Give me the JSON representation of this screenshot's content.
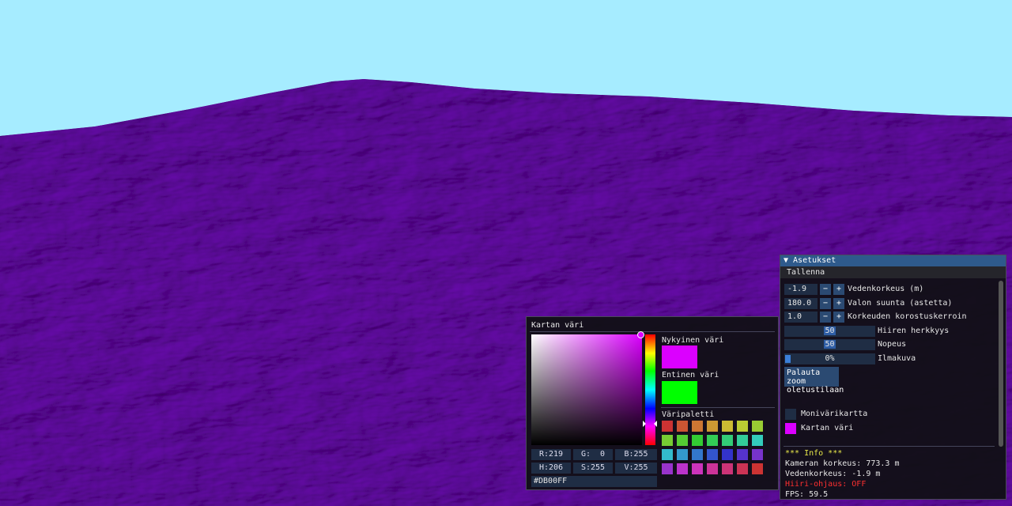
{
  "colors": {
    "sky": "#A6ECFF",
    "terrain": "#7A04A8",
    "terrain_dark": "#3A0052",
    "terrain_light": "#A020D8"
  },
  "color_picker": {
    "title": "Kartan väri",
    "current_label": "Nykyinen väri",
    "previous_label": "Entinen väri",
    "palette_label": "Väripaletti",
    "current_color": "#DB00FF",
    "previous_color": "#00FF00",
    "hue_color": "#DB00FF",
    "channels": {
      "r": "R:219",
      "g": "G:  0",
      "b": "B:255",
      "h": "H:206",
      "s": "S:255",
      "v": "V:255"
    },
    "hex": "#DB00FF",
    "palette": [
      "#cc3333",
      "#cc5533",
      "#cc7733",
      "#cc9933",
      "#ccbb33",
      "#bbcc33",
      "#99cc33",
      "#77cc33",
      "#55cc33",
      "#33cc33",
      "#33cc55",
      "#33cc77",
      "#33cc99",
      "#33ccbb",
      "#33bbcc",
      "#3399cc",
      "#3377cc",
      "#3355cc",
      "#3333cc",
      "#5533cc",
      "#7733cc",
      "#9933cc",
      "#bb33cc",
      "#cc33bb",
      "#cc3399",
      "#cc3377",
      "#cc3355",
      "#cc3333"
    ]
  },
  "settings": {
    "title": "▼ Asetukset",
    "menu_save": "Tallenna",
    "water_level": {
      "value": "-1.9",
      "label": "Vedenkorkeus (m)"
    },
    "light_direction": {
      "value": "180.0",
      "label": "Valon suunta (astetta)"
    },
    "height_exaggeration": {
      "value": "1.0",
      "label": "Korkeuden korostuskerroin"
    },
    "minus": "−",
    "plus": "+",
    "mouse_sensitivity": {
      "value": "50",
      "label": "Hiiren herkkyys",
      "fraction": 0.5
    },
    "speed": {
      "value": "50",
      "label": "Nopeus",
      "fraction": 0.5
    },
    "aerial": {
      "value": "0%",
      "label": "Ilmakuva",
      "fraction": 0.0
    },
    "reset_zoom_line1": "Palauta zoom",
    "reset_zoom_line2": "oletustilaan",
    "multicolor_map": {
      "label": "Monivärikartta",
      "color": "#1f2d44"
    },
    "map_color": {
      "label": "Kartan väri",
      "color": "#DB00FF"
    },
    "info_header": "*** Info ***",
    "camera_height": "Kameran korkeus: 773.3 m",
    "water_height": "Vedenkorkeus: -1.9 m",
    "mouse_control": "Hiiri-ohjaus: OFF",
    "fps": "FPS: 59.5"
  }
}
